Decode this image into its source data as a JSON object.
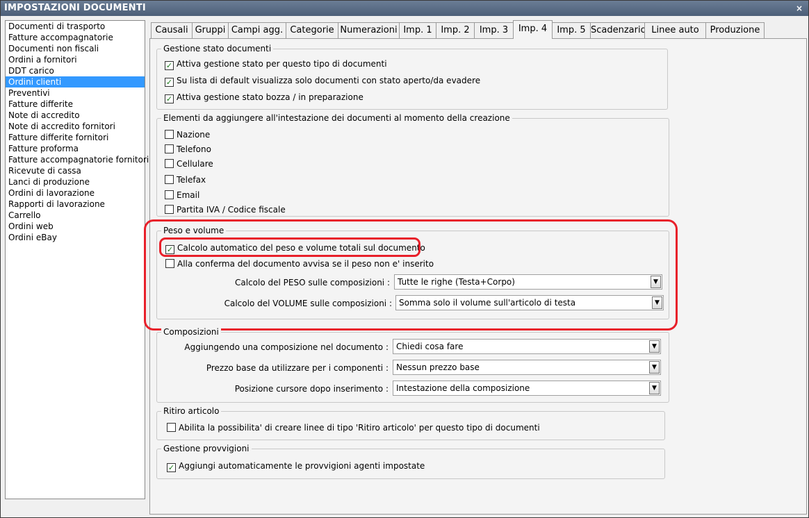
{
  "window": {
    "title": "IMPOSTAZIONI DOCUMENTI",
    "close_glyph": "×"
  },
  "doc_types": [
    "Documenti di trasporto",
    "Fatture accompagnatorie",
    "Documenti non fiscali",
    "Ordini a fornitori",
    "DDT carico",
    "Ordini clienti",
    "Preventivi",
    "Fatture differite",
    "Note di accredito",
    "Note di accredito fornitori",
    "Fatture differite fornitori",
    "Fatture proforma",
    "Fatture accompagnatorie fornitori",
    "Ricevute di cassa",
    "Lanci di produzione",
    "Ordini di lavorazione",
    "Rapporti di lavorazione",
    "Carrello",
    "Ordini web",
    "Ordini eBay"
  ],
  "selected_doc_type": "Ordini clienti",
  "tabs": [
    "Causali",
    "Gruppi",
    "Campi agg.",
    "Categorie",
    "Numerazioni",
    "Imp. 1",
    "Imp. 2",
    "Imp. 3",
    "Imp. 4",
    "Imp. 5",
    "Scadenzario",
    "Linee auto",
    "Produzione"
  ],
  "active_tab": "Imp. 4",
  "gestione_stato": {
    "title": "Gestione stato documenti",
    "options": [
      {
        "label": "Attiva gestione stato per questo tipo di documenti",
        "checked": true
      },
      {
        "label": "Su lista di default visualizza solo documenti con stato aperto/da evadere",
        "checked": true
      },
      {
        "label": "Attiva gestione stato bozza / in preparazione",
        "checked": true
      }
    ]
  },
  "elementi": {
    "title": "Elementi da aggiungere all'intestazione dei documenti al momento della creazione",
    "options": [
      {
        "label": "Nazione",
        "checked": false
      },
      {
        "label": "Telefono",
        "checked": false
      },
      {
        "label": "Cellulare",
        "checked": false
      },
      {
        "label": "Telefax",
        "checked": false
      },
      {
        "label": "Email",
        "checked": false
      },
      {
        "label": "Partita IVA / Codice fiscale",
        "checked": false
      }
    ]
  },
  "peso_volume": {
    "title": "Peso e volume",
    "calcolo_automatico": {
      "label": "Calcolo automatico del peso e volume totali sul documento",
      "checked": true
    },
    "avvisa": {
      "label": "Alla conferma del documento avvisa se il peso non e' inserito",
      "checked": false
    },
    "peso_label": "Calcolo del PESO sulle composizioni :",
    "peso_value": "Tutte le righe (Testa+Corpo)",
    "volume_label": "Calcolo del VOLUME sulle composizioni :",
    "volume_value": "Somma solo il volume sull'articolo di testa"
  },
  "composizioni": {
    "title": "Composizioni",
    "aggiungendo_label": "Aggiungendo una composizione nel documento :",
    "aggiungendo_value": "Chiedi cosa fare",
    "prezzo_label": "Prezzo base da utilizzare per i componenti :",
    "prezzo_value": "Nessun prezzo base",
    "posizione_label": "Posizione cursore dopo inserimento :",
    "posizione_value": "Intestazione della composizione"
  },
  "ritiro": {
    "title": "Ritiro articolo",
    "option": {
      "label": "Abilita la possibilita' di creare linee di tipo 'Ritiro articolo' per questo tipo di documenti",
      "checked": false
    }
  },
  "provvigioni": {
    "title": "Gestione provvigioni",
    "option": {
      "label": "Aggiungi automaticamente le provvigioni agenti impostate",
      "checked": true
    }
  },
  "colors": {
    "titlebar": "#4c5f78",
    "selection": "#3399ff",
    "highlight": "#e8202a",
    "check": "#1a7a1a"
  },
  "icons": {
    "check": "✓",
    "dropdown": "▼"
  }
}
